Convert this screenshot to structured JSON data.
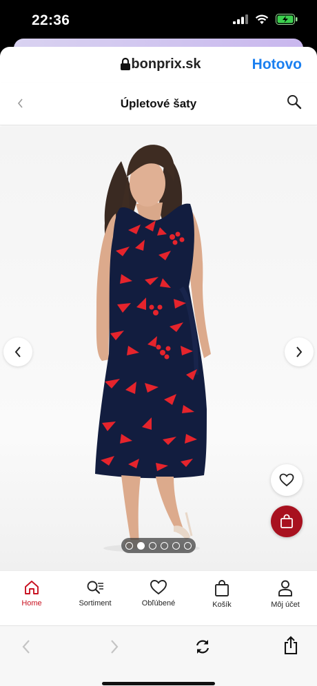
{
  "status_bar": {
    "time": "22:36"
  },
  "browser_header": {
    "domain": "bonprix.sk",
    "done_label": "Hotovo"
  },
  "page_header": {
    "title": "Úpletové šaty"
  },
  "gallery": {
    "image_count": 6,
    "active_index": 1,
    "dress_colors": {
      "base": "#121d3f",
      "print": "#e5242c"
    }
  },
  "bottom_nav": {
    "items": [
      {
        "label": "Home",
        "icon": "home-icon",
        "active": true
      },
      {
        "label": "Sortiment",
        "icon": "search-list-icon",
        "active": false
      },
      {
        "label": "Obľúbené",
        "icon": "heart-icon",
        "active": false
      },
      {
        "label": "Košík",
        "icon": "shopping-bag-icon",
        "active": false
      },
      {
        "label": "Môj účet",
        "icon": "user-icon",
        "active": false
      }
    ]
  },
  "colors": {
    "accent": "#c8101f",
    "link": "#1a7ff0",
    "cart_button": "#a8111f"
  }
}
